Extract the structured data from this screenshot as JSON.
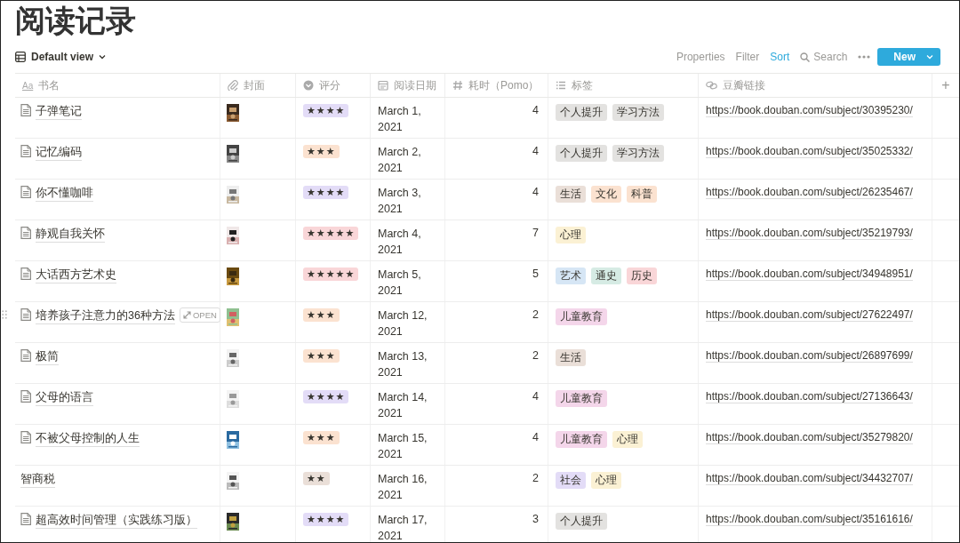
{
  "page": {
    "title": "阅读记录"
  },
  "view": {
    "label": "Default view"
  },
  "toolbar": [
    {
      "label": "Properties",
      "active": false
    },
    {
      "label": "Filter",
      "active": false
    },
    {
      "label": "Sort",
      "active": true
    },
    {
      "label": "Search",
      "active": false
    }
  ],
  "new_button": {
    "label": "New"
  },
  "table": {
    "columns": [
      {
        "label": "书名",
        "kind": "title",
        "icon_text": "Aa"
      },
      {
        "label": "封面",
        "kind": "files"
      },
      {
        "label": "评分",
        "kind": "select"
      },
      {
        "label": "阅读日期",
        "kind": "date"
      },
      {
        "label": "耗时（Pomo）",
        "kind": "number"
      },
      {
        "label": "标签",
        "kind": "multi_select"
      },
      {
        "label": "豆瓣链接",
        "kind": "url"
      }
    ],
    "add_column": "+",
    "rows": [
      {
        "title": "子弹笔记",
        "page_icon": true,
        "cover": {
          "kind": "picture"
        },
        "rating": {
          "text": "★★★★",
          "color": "#e3dcf7"
        },
        "date": "March 1, 2021",
        "pomo": "4",
        "tags": [
          {
            "text": "个人提升",
            "color": "#e3e2e0"
          },
          {
            "text": "学习方法",
            "color": "#e3e2e0"
          }
        ],
        "link": "https://book.douban.com/subject/30395230/"
      },
      {
        "title": "记忆编码",
        "page_icon": true,
        "cover": {
          "kind": "picture"
        },
        "rating": {
          "text": "★★★",
          "color": "#fbe2d0"
        },
        "date": "March 2, 2021",
        "pomo": "4",
        "tags": [
          {
            "text": "个人提升",
            "color": "#e3e2e0"
          },
          {
            "text": "学习方法",
            "color": "#e3e2e0"
          }
        ],
        "link": "https://book.douban.com/subject/35025332/"
      },
      {
        "title": "你不懂咖啡",
        "page_icon": true,
        "cover": {
          "kind": "picture"
        },
        "rating": {
          "text": "★★★★",
          "color": "#e3dcf7"
        },
        "date": "March 3, 2021",
        "pomo": "4",
        "tags": [
          {
            "text": "生活",
            "color": "#eadfd8"
          },
          {
            "text": "文化",
            "color": "#fbe2d0"
          },
          {
            "text": "科普",
            "color": "#fbe2d0"
          }
        ],
        "link": "https://book.douban.com/subject/26235467/"
      },
      {
        "title": "静观自我关怀",
        "page_icon": true,
        "cover": {
          "kind": "picture"
        },
        "rating": {
          "text": "★★★★★",
          "color": "#f9d6d8"
        },
        "date": "March 4, 2021",
        "pomo": "7",
        "tags": [
          {
            "text": "心理",
            "color": "#fbf1d4"
          }
        ],
        "link": "https://book.douban.com/subject/35219793/"
      },
      {
        "title": "大话西方艺术史",
        "page_icon": true,
        "cover": {
          "kind": "picture"
        },
        "rating": {
          "text": "★★★★★",
          "color": "#f9d6d8"
        },
        "date": "March 5, 2021",
        "pomo": "5",
        "tags": [
          {
            "text": "艺术",
            "color": "#d6e6f5"
          },
          {
            "text": "通史",
            "color": "#d6ebe4"
          },
          {
            "text": "历史",
            "color": "#f9d6d8"
          }
        ],
        "link": "https://book.douban.com/subject/34948951/"
      },
      {
        "title": "培养孩子注意力的36种方法",
        "page_icon": true,
        "open_button": "OPEN",
        "cover": {
          "kind": "picture"
        },
        "rating": {
          "text": "★★★",
          "color": "#fbe2d0"
        },
        "date": "March 12, 2021",
        "pomo": "2",
        "tags": [
          {
            "text": "儿童教育",
            "color": "#f4d6ea"
          }
        ],
        "link": "https://book.douban.com/subject/27622497/"
      },
      {
        "title": "极简",
        "page_icon": true,
        "cover": {
          "kind": "picture"
        },
        "rating": {
          "text": "★★★",
          "color": "#fbe2d0"
        },
        "date": "March 13, 2021",
        "pomo": "2",
        "tags": [
          {
            "text": "生活",
            "color": "#eadfd8"
          }
        ],
        "link": "https://book.douban.com/subject/26897699/"
      },
      {
        "title": "父母的语言",
        "page_icon": true,
        "cover": {
          "kind": "picture"
        },
        "rating": {
          "text": "★★★★",
          "color": "#e3dcf7"
        },
        "date": "March 14, 2021",
        "pomo": "4",
        "tags": [
          {
            "text": "儿童教育",
            "color": "#f4d6ea"
          }
        ],
        "link": "https://book.douban.com/subject/27136643/"
      },
      {
        "title": "不被父母控制的人生",
        "page_icon": true,
        "cover": {
          "kind": "picture"
        },
        "rating": {
          "text": "★★★",
          "color": "#fbe2d0"
        },
        "date": "March 15, 2021",
        "pomo": "4",
        "tags": [
          {
            "text": "儿童教育",
            "color": "#f4d6ea"
          },
          {
            "text": "心理",
            "color": "#fbf1d4"
          }
        ],
        "link": "https://book.douban.com/subject/35279820/"
      },
      {
        "title": "智商税",
        "page_icon": false,
        "cover": {
          "kind": "picture"
        },
        "rating": {
          "text": "★★",
          "color": "#eadfd8"
        },
        "date": "March 16, 2021",
        "pomo": "2",
        "tags": [
          {
            "text": "社会",
            "color": "#e3dcf7"
          },
          {
            "text": "心理",
            "color": "#fbf1d4"
          }
        ],
        "link": "https://book.douban.com/subject/34432707/"
      },
      {
        "title": "超高效时间管理（实践练习版）",
        "page_icon": true,
        "cover": {
          "kind": "picture"
        },
        "rating": {
          "text": "★★★★",
          "color": "#e3dcf7"
        },
        "date": "March 17, 2021",
        "pomo": "3",
        "tags": [
          {
            "text": "个人提升",
            "color": "#e3e2e0"
          }
        ],
        "link": "https://book.douban.com/subject/35161616/"
      }
    ]
  }
}
